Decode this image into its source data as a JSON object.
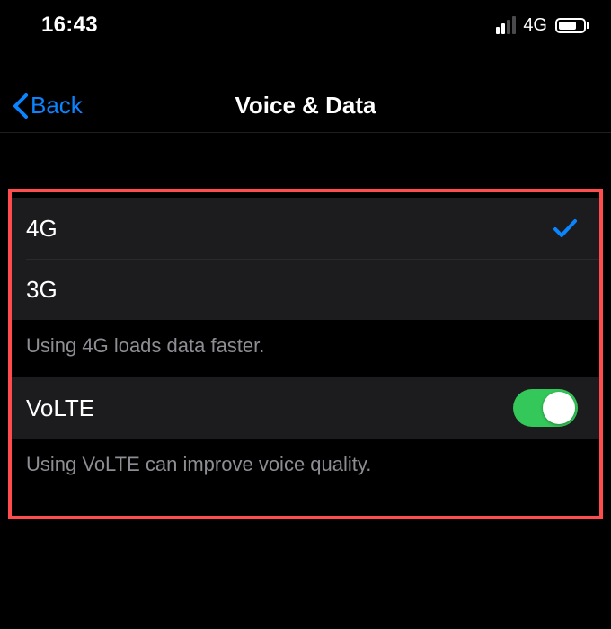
{
  "status": {
    "time": "16:43",
    "network_label": "4G"
  },
  "nav": {
    "back_label": "Back",
    "title": "Voice & Data"
  },
  "options": {
    "items": [
      {
        "label": "4G",
        "selected": true
      },
      {
        "label": "3G",
        "selected": false
      }
    ],
    "footer": "Using 4G loads data faster."
  },
  "volte": {
    "label": "VoLTE",
    "on": true,
    "footer": "Using VoLTE can improve voice quality."
  },
  "colors": {
    "accent": "#0a84ff",
    "toggle_on": "#34c759",
    "highlight": "#ff4d4d"
  }
}
